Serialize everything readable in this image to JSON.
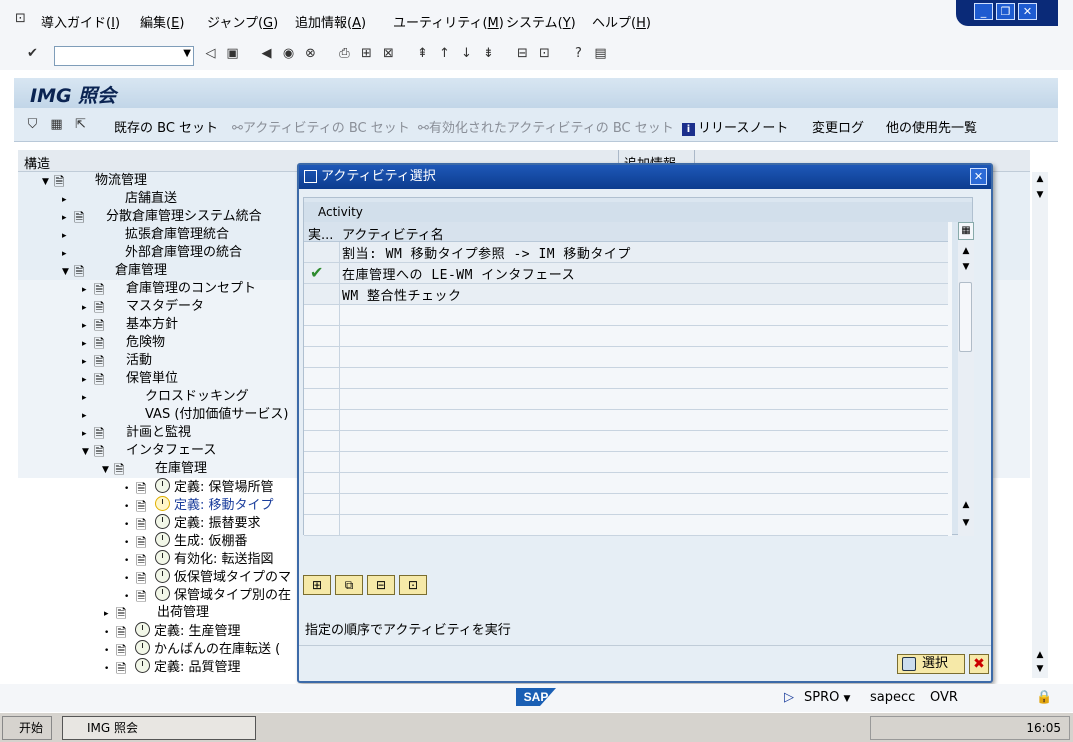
{
  "menu": {
    "items": [
      {
        "label": "導入ガイド",
        "key": "I"
      },
      {
        "label": "編集",
        "key": "E"
      },
      {
        "label": "ジャンプ",
        "key": "G"
      },
      {
        "label": "追加情報",
        "key": "A"
      },
      {
        "label": "ユーティリティ",
        "key": "M"
      },
      {
        "label": "システム",
        "key": "Y"
      },
      {
        "label": "ヘルプ",
        "key": "H"
      }
    ]
  },
  "window_controls": {
    "minimize": "_",
    "restore": "❐",
    "close": "✕"
  },
  "page": {
    "title": "IMG 照会"
  },
  "app_toolbar": {
    "bc_set": "既存の BC セット",
    "activity_bc_set": "アクティビティの BC セット",
    "activated_bc_set": "有効化されたアクティビティの BC セット",
    "release_notes": "リリースノート",
    "change_log": "変更ログ",
    "other_usage": "他の使用先一覧"
  },
  "tree": {
    "col_structure": "構造",
    "col_info": "追加情報",
    "rows": [
      {
        "label": "物流管理",
        "expanded": true
      },
      {
        "label": "店舗直送"
      },
      {
        "label": "分散倉庫管理システム統合"
      },
      {
        "label": "拡張倉庫管理統合"
      },
      {
        "label": "外部倉庫管理の統合"
      },
      {
        "label": "倉庫管理",
        "expanded": true
      },
      {
        "label": "倉庫管理のコンセプト"
      },
      {
        "label": "マスタデータ"
      },
      {
        "label": "基本方針"
      },
      {
        "label": "危険物"
      },
      {
        "label": "活動"
      },
      {
        "label": "保管単位"
      },
      {
        "label": "クロスドッキング"
      },
      {
        "label": "VAS (付加価値サービス)"
      },
      {
        "label": "計画と監視"
      },
      {
        "label": "インタフェース",
        "expanded": true
      },
      {
        "label": "在庫管理",
        "expanded": true
      },
      {
        "label": "定義: 保管場所管"
      },
      {
        "label": "定義: 移動タイプ"
      },
      {
        "label": "定義: 振替要求"
      },
      {
        "label": "生成: 仮棚番"
      },
      {
        "label": "有効化: 転送指図"
      },
      {
        "label": "仮保管域タイプのマ"
      },
      {
        "label": "保管域タイプ別の在"
      },
      {
        "label": "出荷管理"
      },
      {
        "label": "定義: 生産管理"
      },
      {
        "label": "かんばんの在庫転送 ("
      },
      {
        "label": "定義: 品質管理"
      }
    ]
  },
  "dialog": {
    "title": "アクティビティ選択",
    "table_caption": "Activity",
    "col_exec": "実...",
    "col_name": "アクティビティ名",
    "rows": [
      {
        "name": "割当: WM 移動タイプ参照 -> IM 移動タイプ",
        "executed": false
      },
      {
        "name": "在庫管理への LE-WM インタフェース",
        "executed": true
      },
      {
        "name": "WM 整合性チェック",
        "executed": false
      }
    ],
    "message": "指定の順序でアクティビティを実行",
    "select_label": "選択"
  },
  "status": {
    "transaction": "SPRO",
    "server": "sapecc",
    "mode": "OVR"
  },
  "taskbar": {
    "start": "开始",
    "task": "IMG 照会",
    "clock": "16:05"
  },
  "colors": {
    "accent": "#0c3c8e",
    "title_text": "#0b2452",
    "tree_band": "#e6eef5",
    "dialog_bg": "#e6eef5",
    "button_yellow": "#f6e9a8",
    "check_green": "#2e8b2e"
  }
}
